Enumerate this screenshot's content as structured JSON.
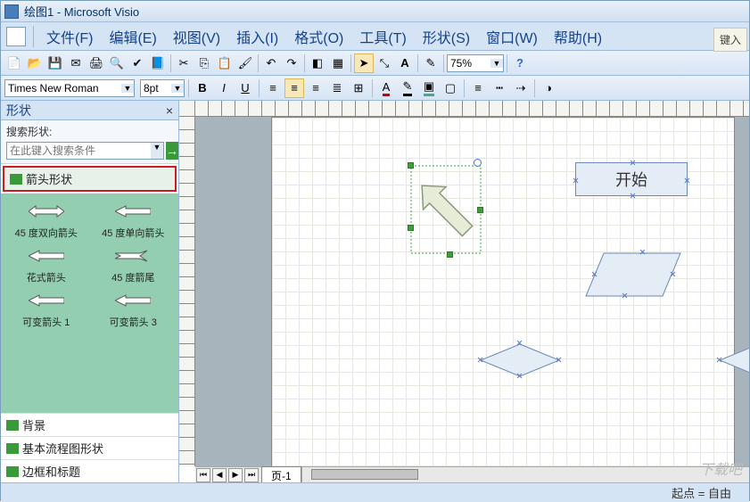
{
  "app": {
    "title": "绘图1 - Microsoft Visio",
    "key_hint": "键入"
  },
  "menu": {
    "file": "文件(F)",
    "edit": "编辑(E)",
    "view": "视图(V)",
    "insert": "插入(I)",
    "format": "格式(O)",
    "tools": "工具(T)",
    "shape": "形状(S)",
    "window": "窗口(W)",
    "help": "帮助(H)"
  },
  "toolbar": {
    "zoom": "75%"
  },
  "format_bar": {
    "font": "Times New Roman",
    "size": "8pt",
    "bold": "B",
    "italic": "I",
    "underline": "U",
    "font_color_letter": "A"
  },
  "shapes_panel": {
    "title": "形状",
    "search_label": "搜索形状:",
    "search_placeholder": "在此键入搜索条件",
    "active_stencil": "箭头形状",
    "shapes": [
      {
        "label": "45 度双向箭头",
        "icon": "double-arrow"
      },
      {
        "label": "45 度单向箭头",
        "icon": "single-arrow"
      },
      {
        "label": "花式箭头",
        "icon": "fancy-arrow"
      },
      {
        "label": "45 度箭尾",
        "icon": "tail-arrow"
      },
      {
        "label": "可变箭头 1",
        "icon": "var-arrow-1"
      },
      {
        "label": "可变箭头 3",
        "icon": "var-arrow-3"
      }
    ],
    "stencils": [
      "背景",
      "基本流程图形状",
      "边框和标题"
    ]
  },
  "canvas": {
    "start_shape_text": "开始",
    "page_tab": "页-1"
  },
  "status": {
    "text": "起点 = 自由"
  },
  "watermark": "下载吧"
}
